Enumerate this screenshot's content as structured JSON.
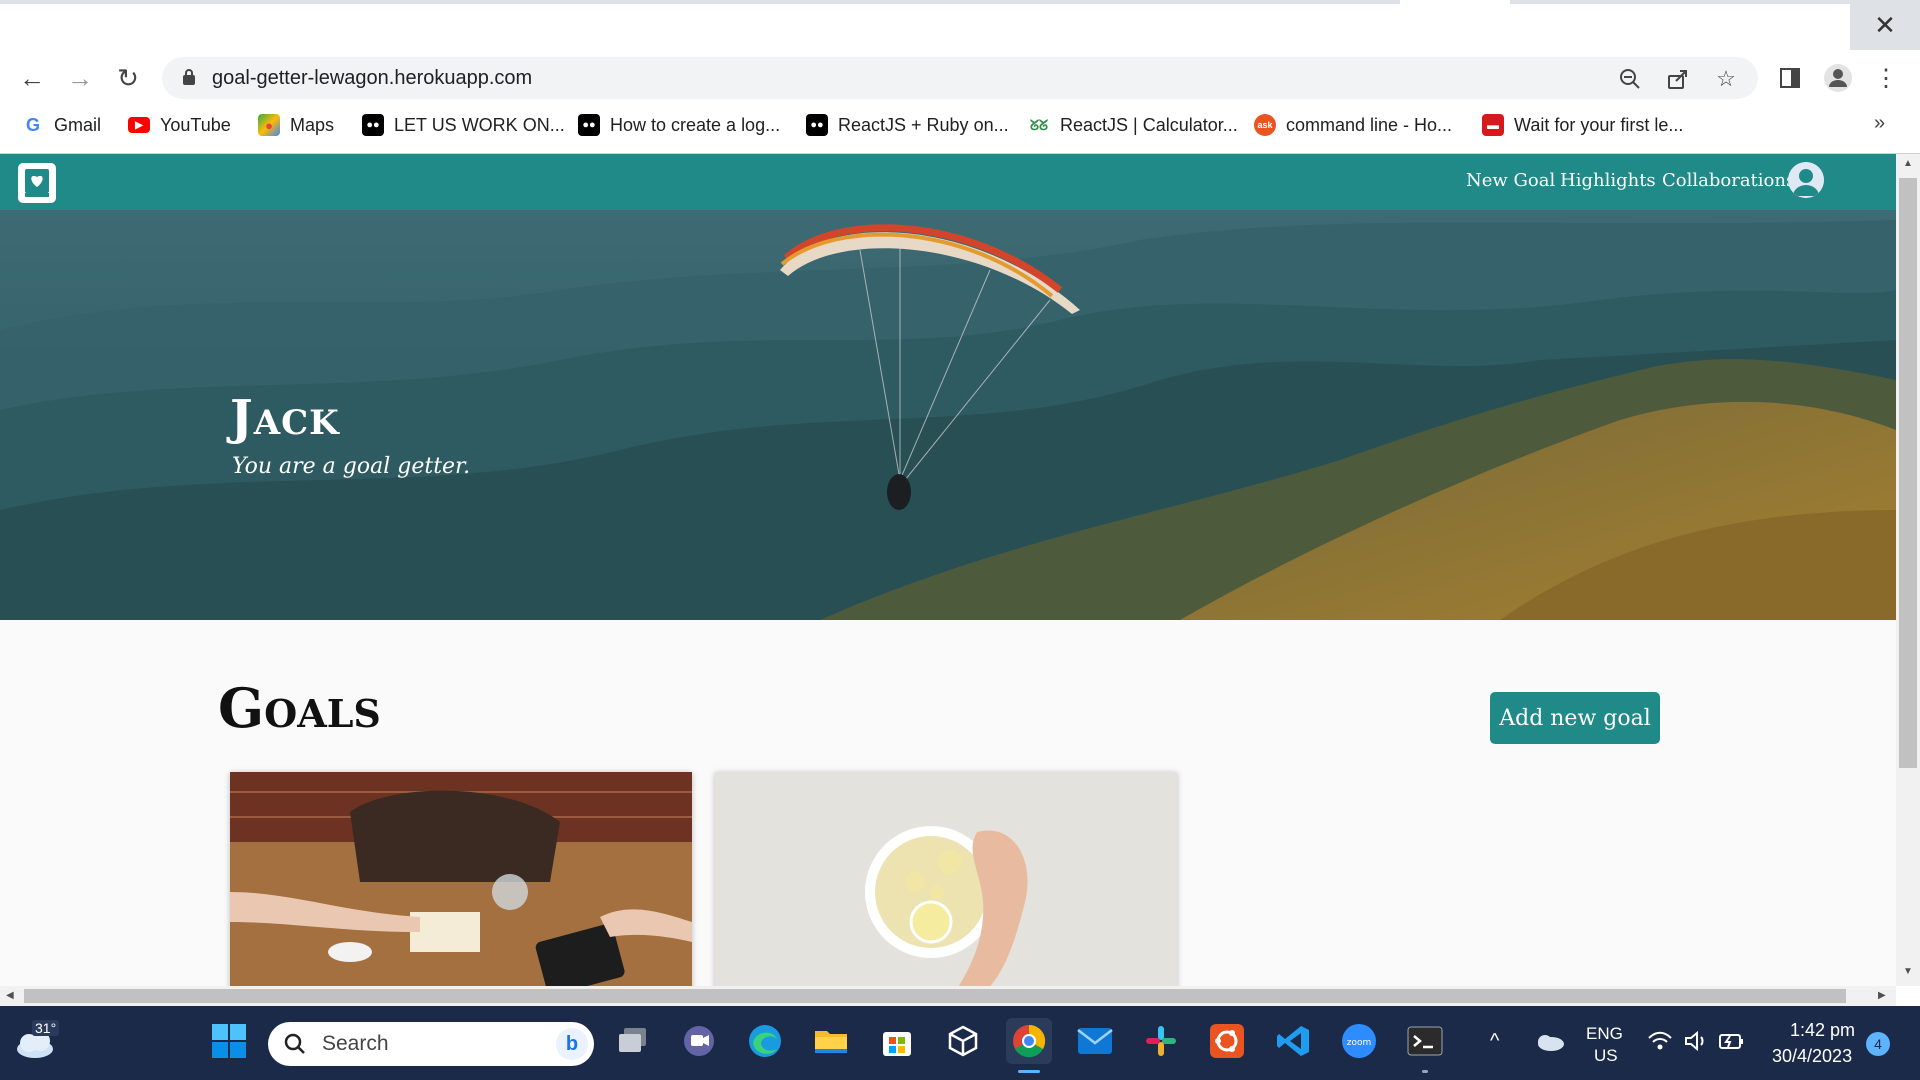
{
  "browser": {
    "url": "goal-getter-lewagon.herokuapp.com",
    "bookmarks": [
      {
        "label": "Gmail",
        "icon": "google-icon"
      },
      {
        "label": "YouTube",
        "icon": "youtube-icon"
      },
      {
        "label": "Maps",
        "icon": "maps-icon"
      },
      {
        "label": "LET US WORK ON...",
        "icon": "medium-icon"
      },
      {
        "label": "How to create a log...",
        "icon": "medium-icon"
      },
      {
        "label": "ReactJS + Ruby on...",
        "icon": "medium-icon"
      },
      {
        "label": "ReactJS | Calculator...",
        "icon": "geeksforgeeks-icon"
      },
      {
        "label": "command line - Ho...",
        "icon": "askubuntu-icon"
      },
      {
        "label": "Wait for your first le...",
        "icon": "bus-icon"
      }
    ],
    "more_bookmarks": "»"
  },
  "site": {
    "nav": {
      "new_goal": "New Goal",
      "highlights": "Highlights",
      "collaborations": "Collaborations"
    },
    "hero": {
      "name": "Jack",
      "tagline": "You are a goal getter."
    },
    "goals": {
      "title": "Goals",
      "add_button": "Add new goal",
      "cards": [
        {
          "image": "coffee-table-meeting-photo"
        },
        {
          "image": "lemon-ginger-tea-photo"
        }
      ]
    },
    "brand_color": "#1f8a87"
  },
  "taskbar": {
    "weather_temp": "31°",
    "search_placeholder": "Search",
    "lang_line1": "ENG",
    "lang_line2": "US",
    "time": "1:42 pm",
    "date": "30/4/2023",
    "notification_count": "4"
  }
}
